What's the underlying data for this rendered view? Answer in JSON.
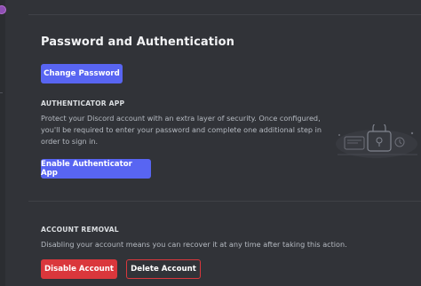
{
  "password_auth": {
    "title": "Password and Authentication",
    "change_password_label": "Change Password"
  },
  "authenticator": {
    "heading": "AUTHENTICATOR APP",
    "description_lines": [
      "Protect your Discord account with an extra layer of security. Once configured,",
      "you'll be required to enter your password and complete one additional step in",
      "order to sign in."
    ],
    "enable_label": "Enable Authenticator App"
  },
  "account_removal": {
    "heading": "ACCOUNT REMOVAL",
    "description": "Disabling your account means you can recover it at any time after taking this action.",
    "disable_label": "Disable Account",
    "delete_label": "Delete Account"
  },
  "colors": {
    "background": "#313338",
    "blurple": "#5865f2",
    "danger": "#da373c",
    "heading": "#f2f3f5",
    "muted_text": "#b5bac1"
  },
  "icons": {
    "illustration": "security-illustration-icon",
    "sidebar_avatar": "server-icon"
  }
}
